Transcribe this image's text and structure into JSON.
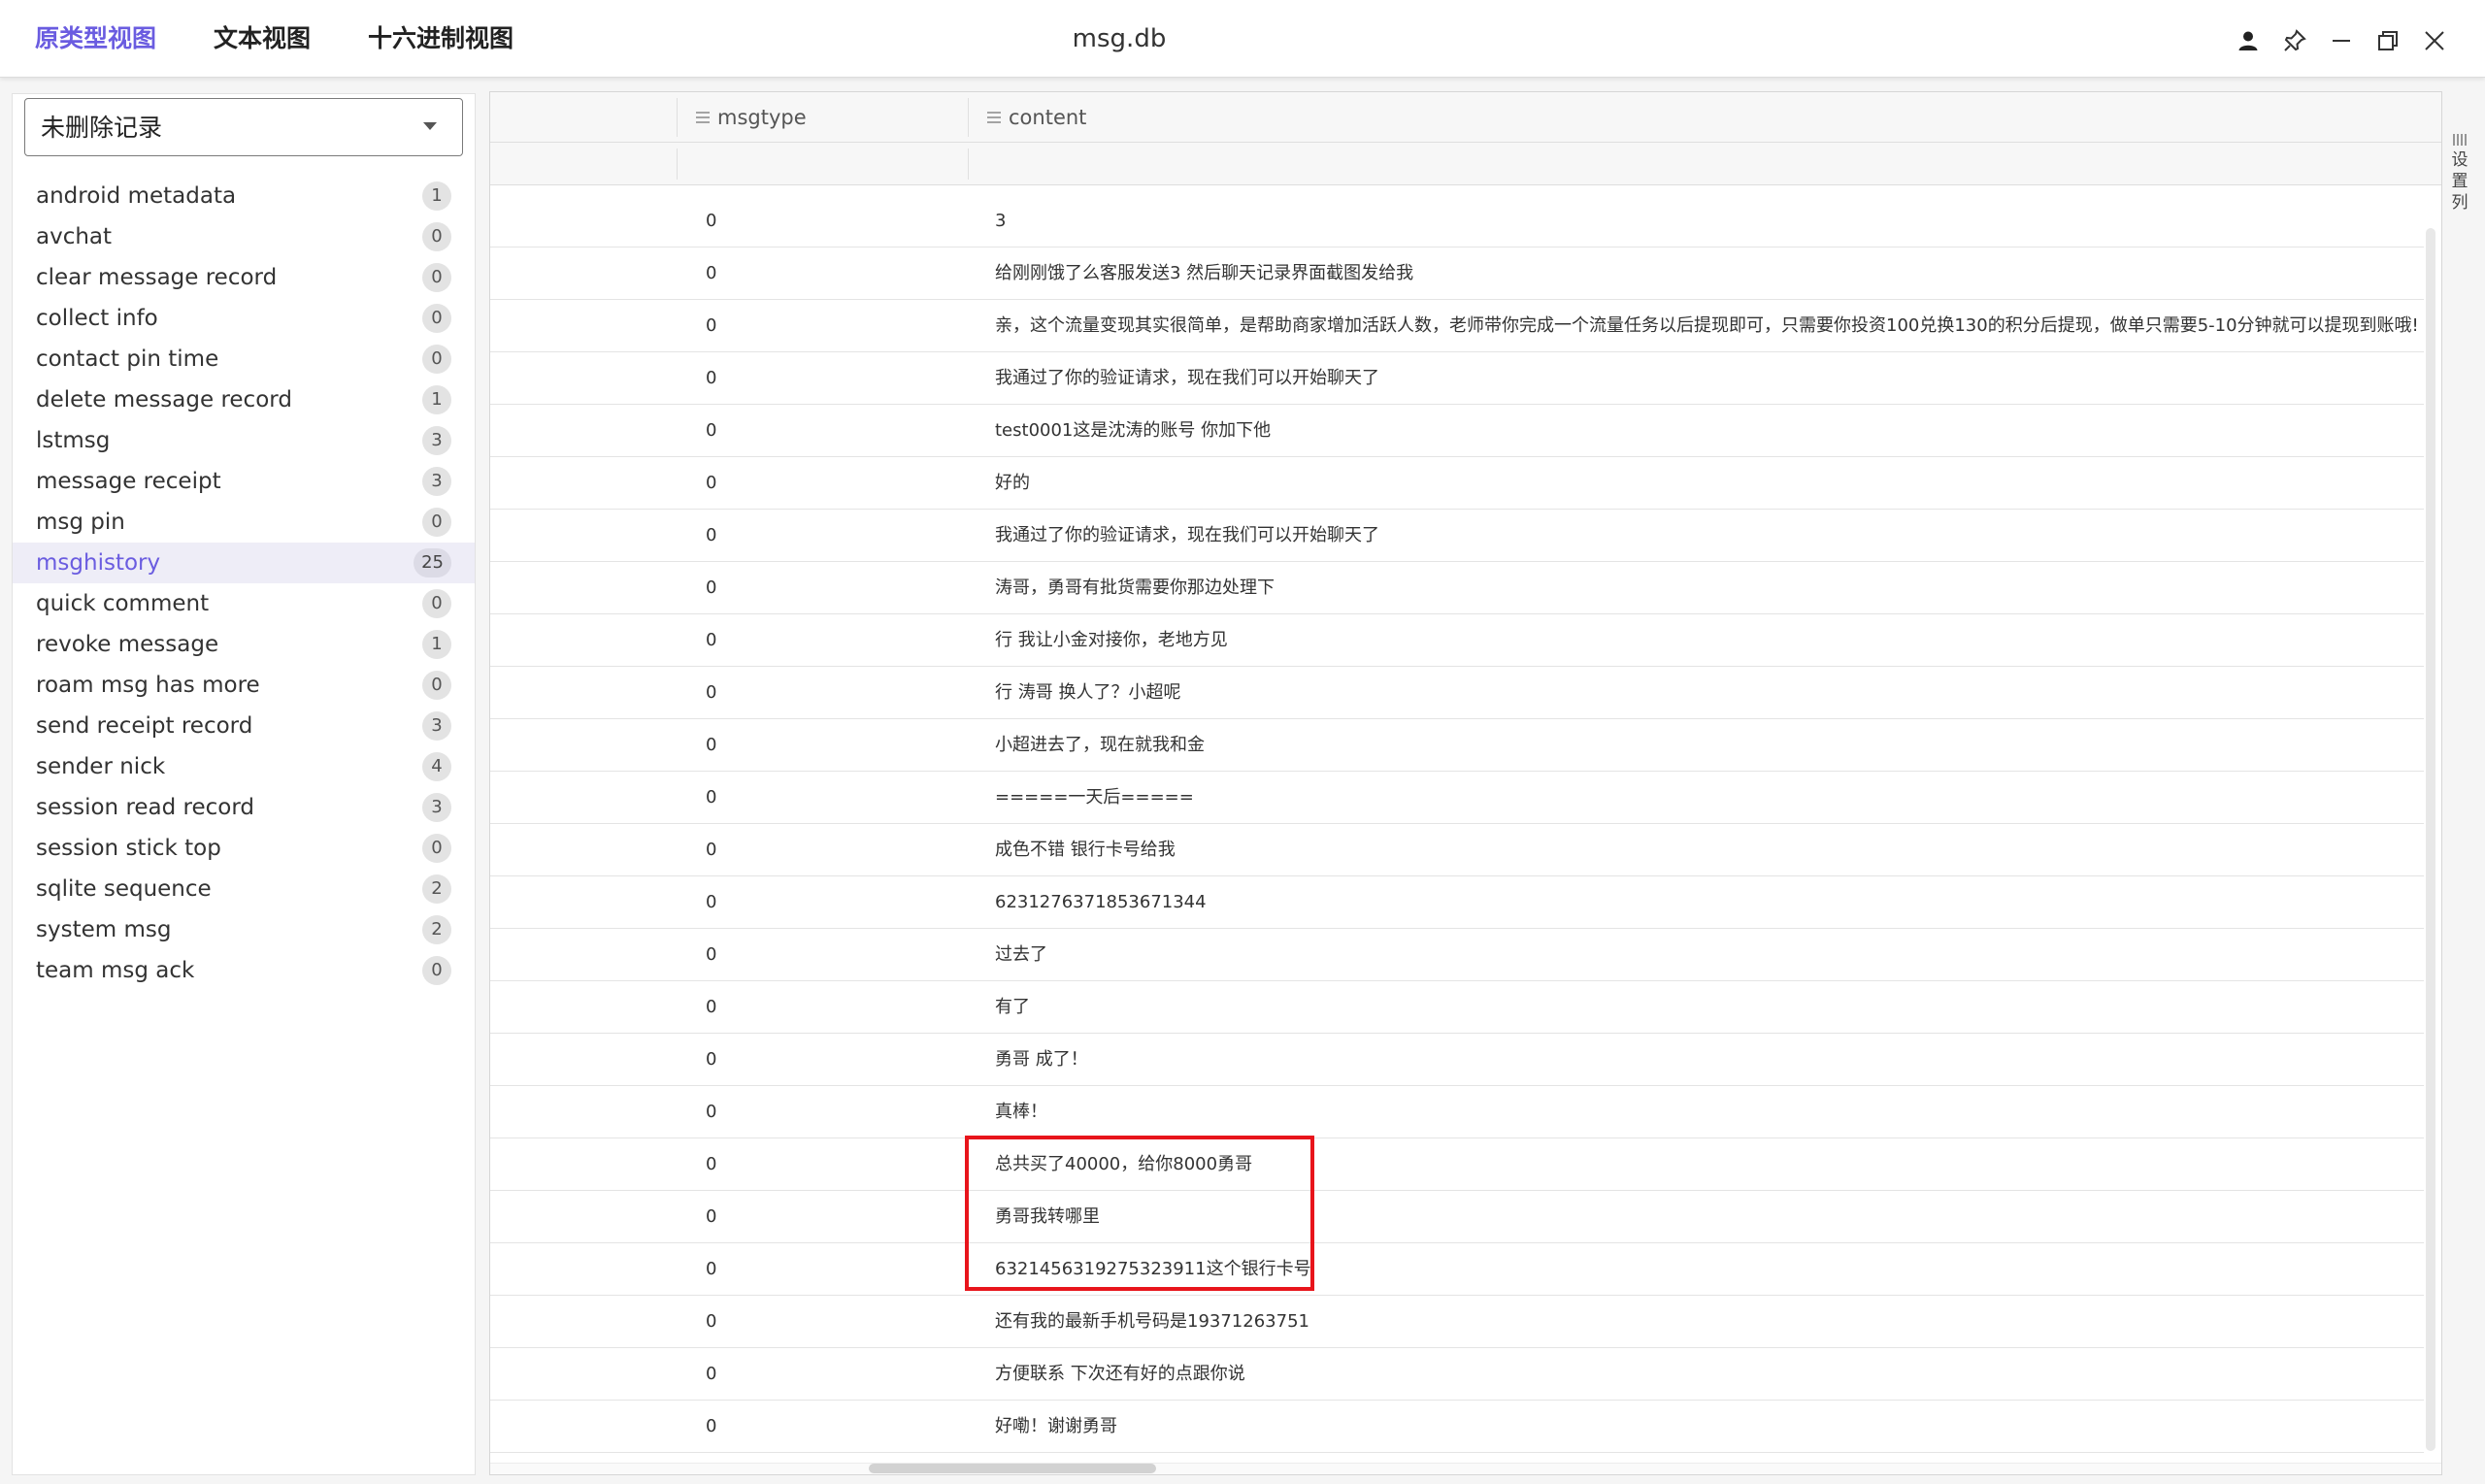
{
  "window": {
    "title": "msg.db",
    "tabs": [
      "原类型视图",
      "文本视图",
      "十六进制视图"
    ],
    "active_tab": 0,
    "accent_color": "#6a5ce0"
  },
  "controls": {
    "user_icon": "user-icon",
    "pin_icon": "pin-icon",
    "minimize_icon": "minimize-icon",
    "restore_icon": "restore-icon",
    "close_icon": "close-icon"
  },
  "sidebar": {
    "filter": {
      "selected": "未删除记录"
    },
    "tables": [
      {
        "name": "android metadata",
        "count": "1"
      },
      {
        "name": "avchat",
        "count": "0"
      },
      {
        "name": "clear message record",
        "count": "0"
      },
      {
        "name": "collect info",
        "count": "0"
      },
      {
        "name": "contact pin time",
        "count": "0"
      },
      {
        "name": "delete message record",
        "count": "1"
      },
      {
        "name": "lstmsg",
        "count": "3"
      },
      {
        "name": "message receipt",
        "count": "3"
      },
      {
        "name": "msg pin",
        "count": "0"
      },
      {
        "name": "msghistory",
        "count": "25"
      },
      {
        "name": "quick comment",
        "count": "0"
      },
      {
        "name": "revoke message",
        "count": "1"
      },
      {
        "name": "roam msg has more",
        "count": "0"
      },
      {
        "name": "send receipt record",
        "count": "3"
      },
      {
        "name": "sender nick",
        "count": "4"
      },
      {
        "name": "session read record",
        "count": "3"
      },
      {
        "name": "session stick top",
        "count": "0"
      },
      {
        "name": "sqlite sequence",
        "count": "2"
      },
      {
        "name": "system msg",
        "count": "2"
      },
      {
        "name": "team msg ack",
        "count": "0"
      }
    ],
    "active_index": 9
  },
  "grid": {
    "columns": [
      "msgtype",
      "content"
    ],
    "settings_label": "设置列",
    "rows": [
      {
        "msgtype": "0",
        "content": "3"
      },
      {
        "msgtype": "0",
        "content": "给刚刚饿了么客服发送3 然后聊天记录界面截图发给我"
      },
      {
        "msgtype": "0",
        "content": "亲，这个流量变现其实很简单，是帮助商家增加活跃人数，老师带你完成一个流量任务以后提现即可，只需要你投资100兑换130的积分后提现，做单只需要5-10分钟就可以提现到账哦!"
      },
      {
        "msgtype": "0",
        "content": "我通过了你的验证请求，现在我们可以开始聊天了"
      },
      {
        "msgtype": "0",
        "content": "test0001这是沈涛的账号 你加下他"
      },
      {
        "msgtype": "0",
        "content": "好的"
      },
      {
        "msgtype": "0",
        "content": "我通过了你的验证请求，现在我们可以开始聊天了"
      },
      {
        "msgtype": "0",
        "content": "涛哥，勇哥有批货需要你那边处理下"
      },
      {
        "msgtype": "0",
        "content": "行 我让小金对接你，老地方见"
      },
      {
        "msgtype": "0",
        "content": "行 涛哥 换人了？小超呢"
      },
      {
        "msgtype": "0",
        "content": "小超进去了，现在就我和金"
      },
      {
        "msgtype": "0",
        "content": "=====一天后====="
      },
      {
        "msgtype": "0",
        "content": "成色不错 银行卡号给我"
      },
      {
        "msgtype": "0",
        "content": "6231276371853671344"
      },
      {
        "msgtype": "0",
        "content": "过去了"
      },
      {
        "msgtype": "0",
        "content": "有了"
      },
      {
        "msgtype": "0",
        "content": "勇哥 成了！"
      },
      {
        "msgtype": "0",
        "content": "真棒！"
      },
      {
        "msgtype": "0",
        "content": "总共买了40000，给你8000勇哥"
      },
      {
        "msgtype": "0",
        "content": "勇哥我转哪里"
      },
      {
        "msgtype": "0",
        "content": "6321456319275323911这个银行卡号"
      },
      {
        "msgtype": "0",
        "content": "还有我的最新手机号码是19371263751"
      },
      {
        "msgtype": "0",
        "content": "方便联系 下次还有好的点跟你说"
      },
      {
        "msgtype": "0",
        "content": "好嘞！谢谢勇哥"
      }
    ]
  }
}
